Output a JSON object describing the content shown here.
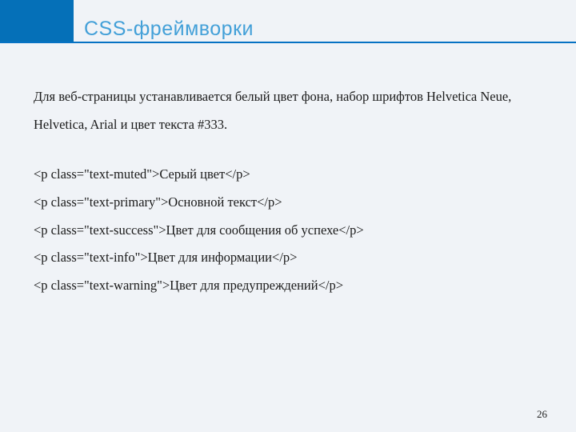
{
  "header": {
    "title": "CSS-фреймворки"
  },
  "content": {
    "intro": "Для веб-страницы устанавливается белый цвет фона, набор шрифтов Helvetica Neue, Helvetica, Arial и цвет текста #333.",
    "lines": [
      "<p class=\"text-muted\">Серый цвет</p>",
      "<p class=\"text-primary\">Основной текст</p>",
      "<p class=\"text-success\">Цвет для сообщения об успехе</p>",
      "<p class=\"text-info\">Цвет для информации</p>",
      "<p class=\"text-warning\">Цвет для предупреждений</p>"
    ]
  },
  "page_number": "26"
}
